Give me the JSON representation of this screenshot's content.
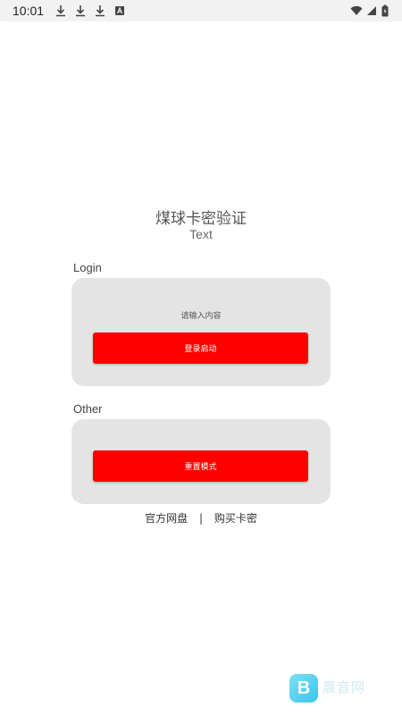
{
  "status_bar": {
    "time": "10:01",
    "left_icons": [
      "download-icon",
      "download-icon",
      "download-icon",
      "font-icon"
    ],
    "right_icons": [
      "wifi-icon",
      "signal-icon",
      "battery-icon"
    ]
  },
  "header": {
    "title": "煤球卡密验证",
    "subtitle": "Text"
  },
  "login": {
    "label": "Login",
    "input_placeholder": "请输入内容",
    "button_label": "登录启动"
  },
  "other": {
    "label": "Other",
    "button_label": "重置模式"
  },
  "links": {
    "netdisk": "官方网盘",
    "separator": "|",
    "buy_card": "购买卡密"
  },
  "watermark": {
    "text": "晨音网"
  },
  "colors": {
    "accent": "#ff0000",
    "card_bg": "#e4e4e4",
    "status_bar_bg": "#f2f2f2"
  }
}
